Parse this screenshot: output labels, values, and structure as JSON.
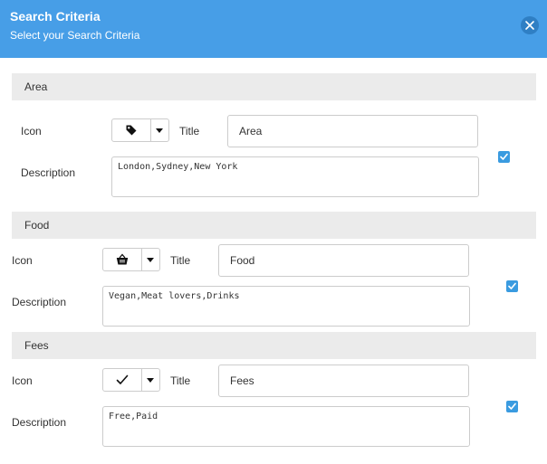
{
  "header": {
    "title": "Search Criteria",
    "subtitle": "Select your Search Criteria",
    "close_icon": "close-x-icon"
  },
  "labels": {
    "icon": "Icon",
    "title": "Title",
    "description": "Description"
  },
  "sections": [
    {
      "name": "Area",
      "icon": "tag-icon",
      "title_value": "Area",
      "description_value": "London,Sydney,New York",
      "checked": true
    },
    {
      "name": "Food",
      "icon": "shopping-basket-icon",
      "title_value": "Food",
      "description_value": "Vegan,Meat lovers,Drinks",
      "checked": true
    },
    {
      "name": "Fees",
      "icon": "checkmark-icon",
      "title_value": "Fees",
      "description_value": "Free,Paid",
      "checked": true
    }
  ],
  "colors": {
    "header": "#479ee7",
    "section_band": "#ebebeb",
    "checkbox": "#3a9be0"
  }
}
